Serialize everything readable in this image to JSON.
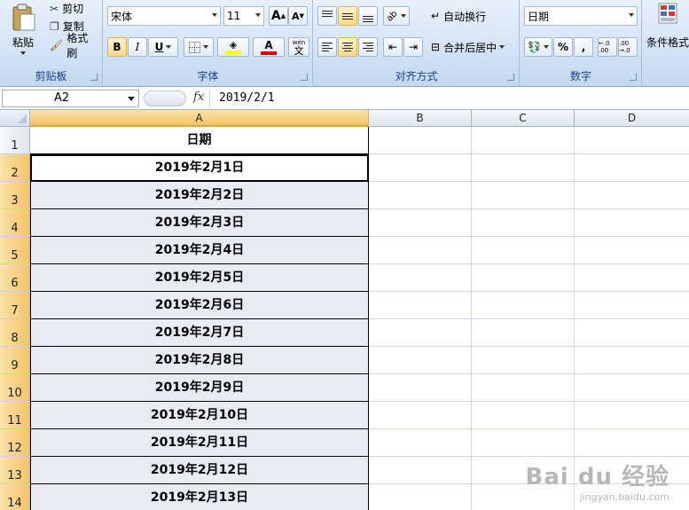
{
  "ribbon": {
    "clipboard": {
      "label": "剪贴板",
      "paste": "粘贴",
      "cut": "剪切",
      "copy": "复制",
      "format_painter": "格式刷"
    },
    "font": {
      "label": "字体",
      "name": "宋体",
      "size": "11",
      "bold": "B",
      "italic": "I",
      "underline": "U",
      "grow": "A",
      "shrink": "A",
      "font_color_glyph": "A",
      "phonetic_top": "wén",
      "phonetic_bottom": "文"
    },
    "alignment": {
      "label": "对齐方式",
      "wrap_text": "自动换行",
      "merge_center": "合并后居中"
    },
    "number": {
      "label": "数字",
      "format": "日期",
      "percent": "%",
      "comma": ",",
      "inc_decimal": "←.0 .00",
      "dec_decimal": ".00 →.0"
    },
    "styles": {
      "conditional_format": "条件格式"
    }
  },
  "formula_bar": {
    "name_box": "A2",
    "fx": "fx",
    "formula": "2019/2/1"
  },
  "columns": [
    "A",
    "B",
    "C",
    "D"
  ],
  "header_cell": "日期",
  "rows": [
    {
      "num": "1",
      "value": "日期"
    },
    {
      "num": "2",
      "value": "2019年2月1日"
    },
    {
      "num": "3",
      "value": "2019年2月2日"
    },
    {
      "num": "4",
      "value": "2019年2月3日"
    },
    {
      "num": "5",
      "value": "2019年2月4日"
    },
    {
      "num": "6",
      "value": "2019年2月5日"
    },
    {
      "num": "7",
      "value": "2019年2月6日"
    },
    {
      "num": "8",
      "value": "2019年2月7日"
    },
    {
      "num": "9",
      "value": "2019年2月8日"
    },
    {
      "num": "10",
      "value": "2019年2月9日"
    },
    {
      "num": "11",
      "value": "2019年2月10日"
    },
    {
      "num": "12",
      "value": "2019年2月11日"
    },
    {
      "num": "13",
      "value": "2019年2月12日"
    },
    {
      "num": "14",
      "value": "2019年2月13日"
    }
  ],
  "watermark": {
    "brand": "Bai du 经验",
    "url": "jingyan.baidu.com"
  },
  "colors": {
    "selected_fill": "#e8eaf4",
    "header_sel": "#f2c468",
    "ribbon_label": "#15428b",
    "font_color_bar": "#e00000",
    "fill_color_bar": "#ffff00"
  }
}
